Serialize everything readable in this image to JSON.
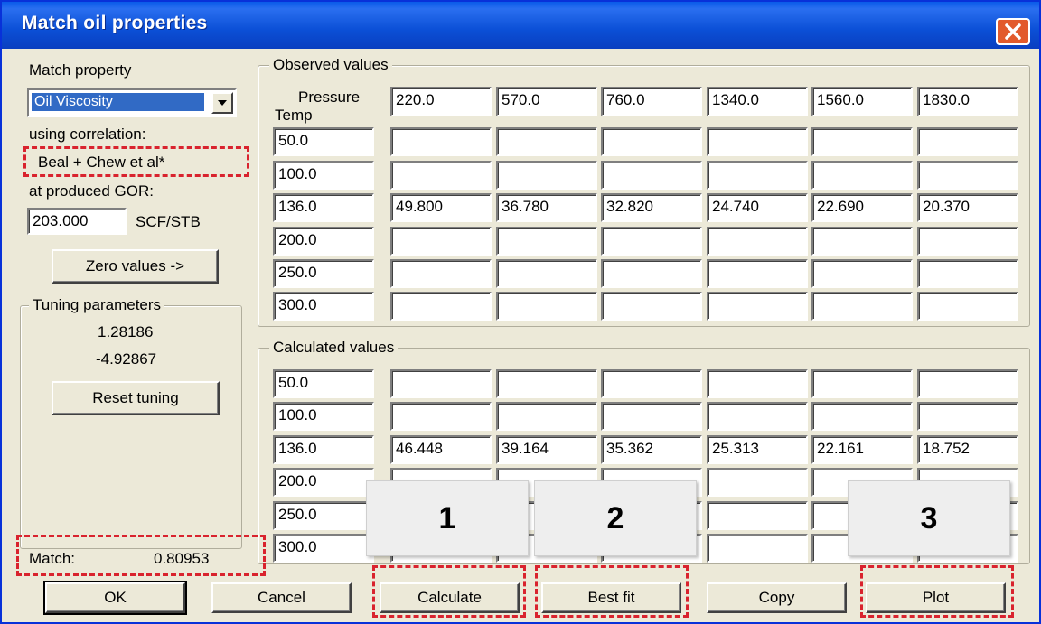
{
  "window": {
    "title": "Match oil properties"
  },
  "left": {
    "match_property_label": "Match property",
    "match_property_value": "Oil Viscosity",
    "using_correlation_label": "using correlation:",
    "correlation_value": "Beal + Chew et al*",
    "gor_label": "at produced GOR:",
    "gor_value": "203.000",
    "gor_unit": "SCF/STB",
    "zero_values_button": "Zero values ->",
    "tuning_title": "Tuning parameters",
    "tuning_value_1": "1.28186",
    "tuning_value_2": "-4.92867",
    "reset_tuning_button": "Reset tuning",
    "match_label": "Match:",
    "match_value": "0.80953"
  },
  "observed": {
    "title": "Observed values",
    "pressure_label": "Pressure",
    "temp_label": "Temp",
    "pressures": [
      "220.0",
      "570.0",
      "760.0",
      "1340.0",
      "1560.0",
      "1830.0"
    ],
    "rows": [
      {
        "temp": "50.0",
        "values": [
          "",
          "",
          "",
          "",
          "",
          ""
        ]
      },
      {
        "temp": "100.0",
        "values": [
          "",
          "",
          "",
          "",
          "",
          ""
        ]
      },
      {
        "temp": "136.0",
        "values": [
          "49.800",
          "36.780",
          "32.820",
          "24.740",
          "22.690",
          "20.370"
        ]
      },
      {
        "temp": "200.0",
        "values": [
          "",
          "",
          "",
          "",
          "",
          ""
        ]
      },
      {
        "temp": "250.0",
        "values": [
          "",
          "",
          "",
          "",
          "",
          ""
        ]
      },
      {
        "temp": "300.0",
        "values": [
          "",
          "",
          "",
          "",
          "",
          ""
        ]
      }
    ]
  },
  "calculated": {
    "title": "Calculated values",
    "rows": [
      {
        "temp": "50.0",
        "values": [
          "",
          "",
          "",
          "",
          "",
          ""
        ]
      },
      {
        "temp": "100.0",
        "values": [
          "",
          "",
          "",
          "",
          "",
          ""
        ]
      },
      {
        "temp": "136.0",
        "values": [
          "46.448",
          "39.164",
          "35.362",
          "25.313",
          "22.161",
          "18.752"
        ]
      },
      {
        "temp": "200.0",
        "values": [
          "",
          "",
          "",
          "",
          "",
          ""
        ]
      },
      {
        "temp": "250.0",
        "values": [
          "",
          "",
          "",
          "",
          "",
          ""
        ]
      },
      {
        "temp": "300.0",
        "values": [
          "",
          "",
          "",
          "",
          "",
          ""
        ]
      }
    ]
  },
  "buttons": {
    "ok": "OK",
    "cancel": "Cancel",
    "calculate": "Calculate",
    "best_fit": "Best fit",
    "copy": "Copy",
    "plot": "Plot"
  },
  "callouts": [
    "1",
    "2",
    "3"
  ],
  "colors": {
    "highlight_dash": "#d9232e",
    "selection": "#316ac5",
    "titlebar": "#0b4fd6"
  }
}
